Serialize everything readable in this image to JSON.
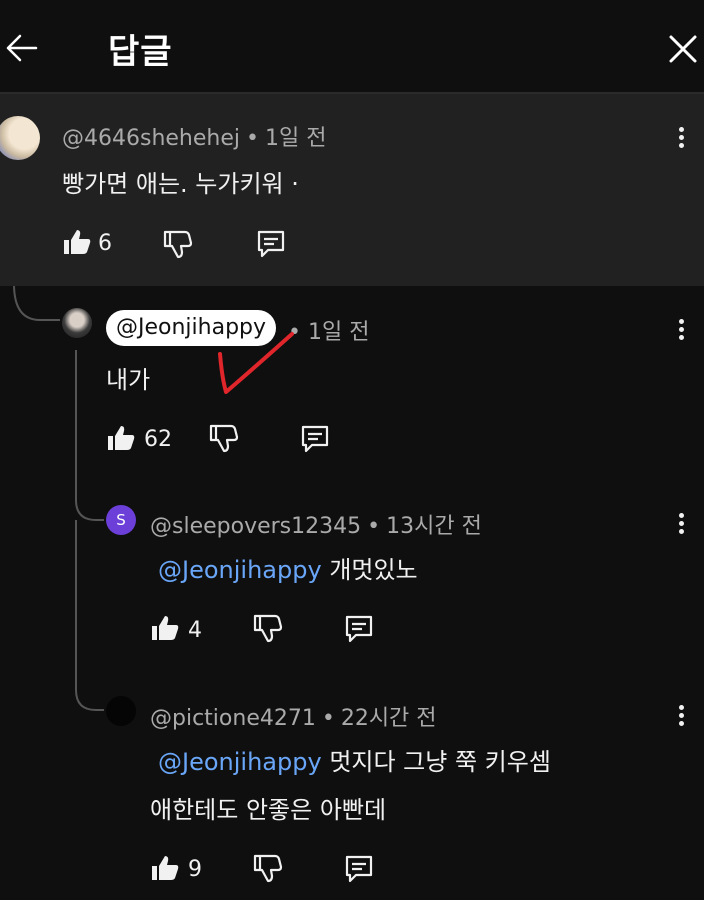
{
  "header": {
    "title": "답글"
  },
  "comments": [
    {
      "handle": "@4646shehehej",
      "time": "1일 전",
      "text": "빵가면 애는. 누가키워 ·",
      "likes": "6"
    },
    {
      "handle": "@Jeonjihappy",
      "time": "1일 전",
      "text": "내가",
      "likes": "62"
    },
    {
      "handle": "@sleepovers12345",
      "time": "13시간 전",
      "mention": "@Jeonjihappy",
      "text": "개멋있노",
      "likes": "4",
      "avatar_letter": "S"
    },
    {
      "handle": "@pictione4271",
      "time": "22시간 전",
      "mention": "@Jeonjihappy",
      "text": "멋지다 그냥 쭉 키우셈",
      "text2": "애한테도 안좋은 아빤데",
      "likes": "9"
    }
  ],
  "icons": [
    "back-arrow-icon",
    "close-icon",
    "thumb-up-icon",
    "thumb-down-icon",
    "reply-icon",
    "more-vert-icon"
  ],
  "colors": {
    "background": "#0f0f0f",
    "parent_bg": "#212121",
    "mention": "#6aa6f8",
    "annotation": "#e0262b",
    "avatar_s": "#6b3fd8"
  }
}
